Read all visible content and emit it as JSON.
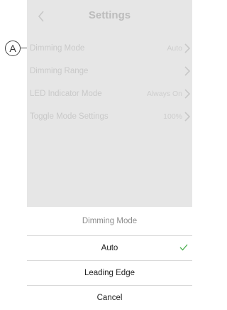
{
  "header": {
    "title": "Settings"
  },
  "settings": [
    {
      "label": "Dimming Mode",
      "value": "Auto"
    },
    {
      "label": "Dimming Range",
      "value": ""
    },
    {
      "label": "LED Indicator Mode",
      "value": "Always On"
    },
    {
      "label": "Toggle Mode Settings",
      "value": "100%"
    }
  ],
  "sheet": {
    "title": "Dimming Mode",
    "options": [
      {
        "label": "Auto",
        "selected": true
      },
      {
        "label": "Leading Edge",
        "selected": false
      }
    ],
    "cancel": "Cancel"
  },
  "callout": {
    "label": "A"
  },
  "colors": {
    "check": "#4caf50",
    "overlay": "#e6e6e6"
  }
}
